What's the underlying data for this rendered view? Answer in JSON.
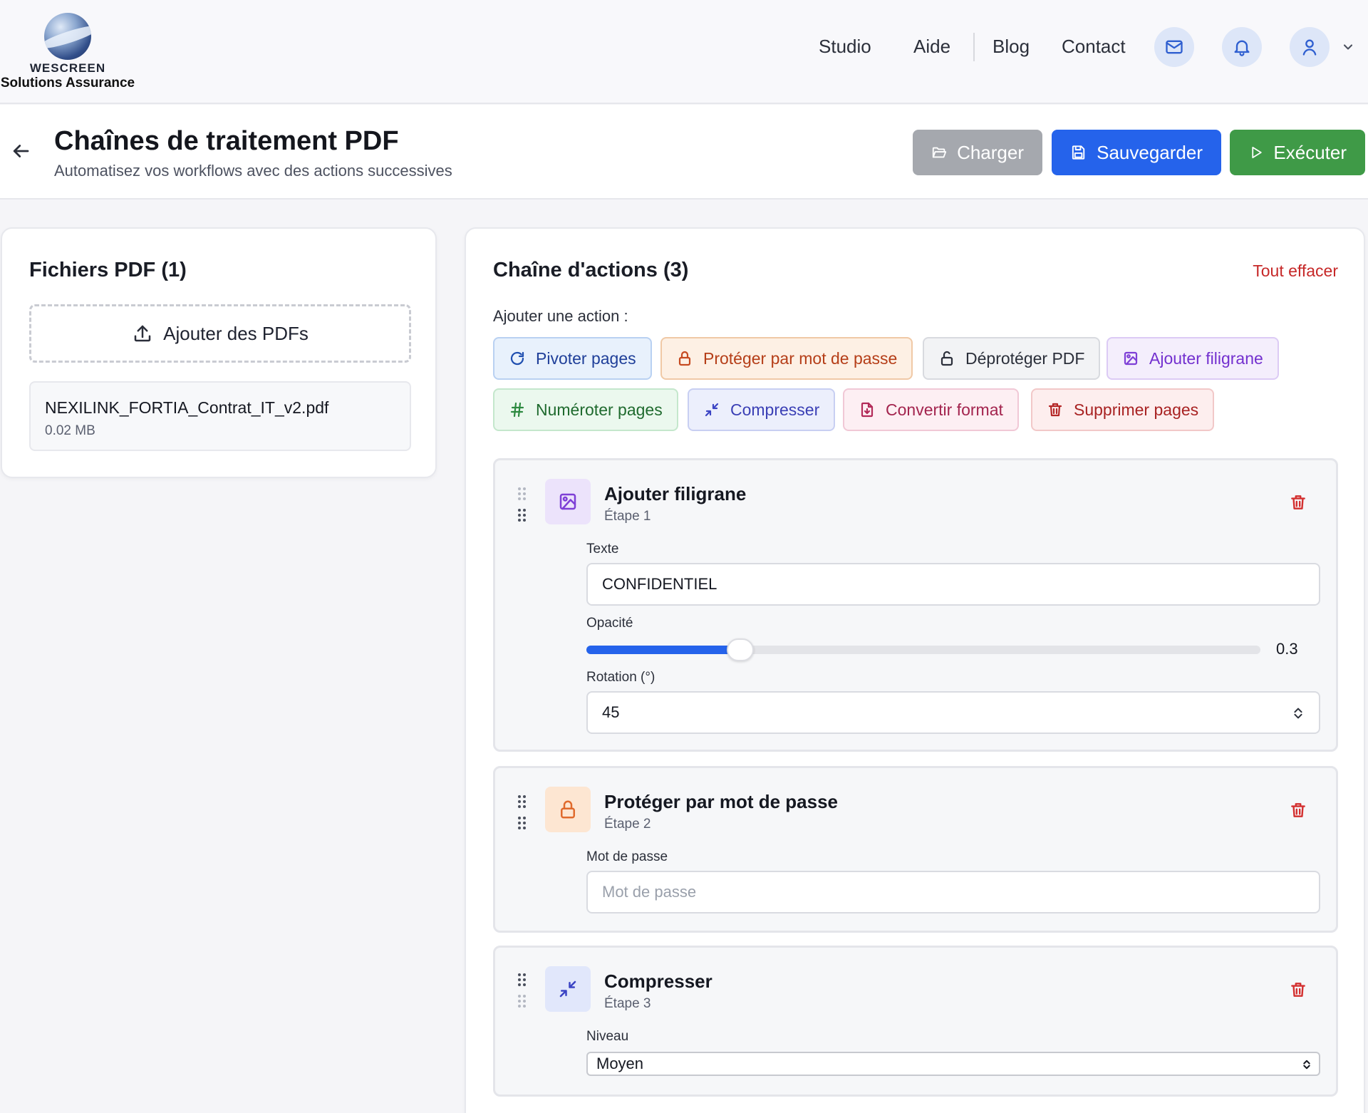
{
  "brand": {
    "name": "WESCREEN",
    "subtitle": "Solutions Assurance"
  },
  "nav": {
    "studio": "Studio",
    "aide": "Aide",
    "blog": "Blog",
    "contact": "Contact"
  },
  "header": {
    "title": "Chaînes de traitement PDF",
    "subtitle": "Automatisez vos workflows avec des actions successives",
    "buttons": {
      "load": "Charger",
      "save": "Sauvegarder",
      "run": "Exécuter"
    }
  },
  "files": {
    "title": "Fichiers PDF (1)",
    "upload_label": "Ajouter des PDFs",
    "items": [
      {
        "name": "NEXILINK_FORTIA_Contrat_IT_v2.pdf",
        "size": "0.02 MB"
      }
    ]
  },
  "chain": {
    "title": "Chaîne d'actions (3)",
    "clear_all": "Tout effacer",
    "add_label": "Ajouter une action :",
    "actions": [
      {
        "label": "Pivoter pages",
        "icon": "rotate-icon"
      },
      {
        "label": "Protéger par mot de passe",
        "icon": "lock-icon"
      },
      {
        "label": "Déprotéger PDF",
        "icon": "unlock-icon"
      },
      {
        "label": "Ajouter filigrane",
        "icon": "image-icon"
      },
      {
        "label": "Numéroter pages",
        "icon": "hash-icon"
      },
      {
        "label": "Compresser",
        "icon": "compress-icon"
      },
      {
        "label": "Convertir format",
        "icon": "file-convert-icon"
      },
      {
        "label": "Supprimer pages",
        "icon": "trash-icon"
      }
    ],
    "steps": [
      {
        "title": "Ajouter filigrane",
        "step": "Étape 1",
        "icon": "image-icon",
        "text_label": "Texte",
        "text_value": "CONFIDENTIEL",
        "opacity_label": "Opacité",
        "opacity_value": "0.3",
        "opacity_fraction": 0.3,
        "rotation_label": "Rotation (°)",
        "rotation_value": "45"
      },
      {
        "title": "Protéger par mot de passe",
        "step": "Étape 2",
        "icon": "lock-icon",
        "password_label": "Mot de passe",
        "password_placeholder": "Mot de passe"
      },
      {
        "title": "Compresser",
        "step": "Étape 3",
        "icon": "compress-icon",
        "level_label": "Niveau",
        "level_value": "Moyen"
      }
    ]
  },
  "colors": {
    "primary": "#2563eb",
    "success": "#3f9a47",
    "muted_button": "#a5a8ae",
    "danger": "#c62828",
    "purple": "#7e3fd6",
    "orange": "#d4582a"
  }
}
